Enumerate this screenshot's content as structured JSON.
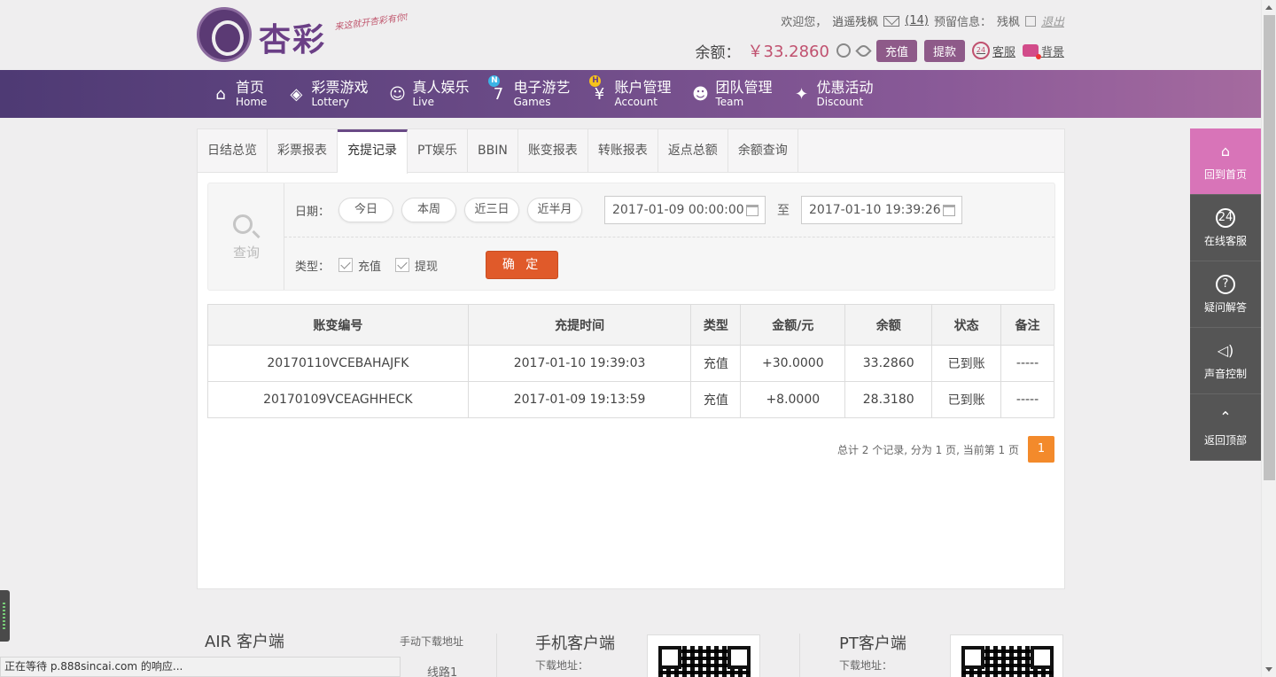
{
  "header": {
    "logo_text": "杏彩",
    "logo_slogan": "来这就开杏彩有你!",
    "welcome": "欢迎您，",
    "username": "逍遥残枫",
    "mail_count": "(14)",
    "reserved_info_label": "预留信息：",
    "reserved_info": "残枫",
    "logout": "退出",
    "balance_label": "余额：",
    "balance_value": "￥33.2860",
    "recharge": "充值",
    "withdraw": "提款",
    "service": "客服",
    "service_icon_text": "24",
    "background": "背景"
  },
  "nav": [
    {
      "cn": "首页",
      "en": "Home",
      "icon": "home-icon"
    },
    {
      "cn": "彩票游戏",
      "en": "Lottery",
      "icon": "lottery-icon"
    },
    {
      "cn": "真人娱乐",
      "en": "Live",
      "icon": "live-icon",
      "badge": "N"
    },
    {
      "cn": "电子游艺",
      "en": "Games",
      "icon": "slot-seven-icon",
      "badge": "H"
    },
    {
      "cn": "账户管理",
      "en": "Account",
      "icon": "yen-coin-icon"
    },
    {
      "cn": "团队管理",
      "en": "Team",
      "icon": "team-icon"
    },
    {
      "cn": "优惠活动",
      "en": "Discount",
      "icon": "gift-icon"
    }
  ],
  "tabs": [
    "日结总览",
    "彩票报表",
    "充提记录",
    "PT娱乐",
    "BBIN",
    "账变报表",
    "转账报表",
    "返点总额",
    "余额查询"
  ],
  "active_tab": "充提记录",
  "query": {
    "title": "查询",
    "date_label": "日期：",
    "quick": [
      "今日",
      "本周",
      "近三日",
      "近半月"
    ],
    "start": "2017-01-09 00:00:00",
    "to": "至",
    "end": "2017-01-10 19:39:26",
    "type_label": "类型：",
    "types": [
      "充值",
      "提现"
    ],
    "confirm": "确 定"
  },
  "table": {
    "headers": [
      "账变编号",
      "充提时间",
      "类型",
      "金额/元",
      "余额",
      "状态",
      "备注"
    ],
    "rows": [
      [
        "20170110VCEBAHAJFK",
        "2017-01-10 19:39:03",
        "充值",
        "+30.0000",
        "33.2860",
        "已到账",
        "-----"
      ],
      [
        "20170109VCEAGHHECK",
        "2017-01-09 19:13:59",
        "充值",
        "+8.0000",
        "28.3180",
        "已到账",
        "-----"
      ]
    ]
  },
  "pager": {
    "summary": "总计 2 个记录, 分为 1 页, 当前第 1 页",
    "page": "1"
  },
  "footer": {
    "air": "AIR 客户端",
    "manual": "手动下载地址",
    "line1": "线路1",
    "mobile": "手机客户端",
    "mobile_dl": "下载地址：",
    "pt": "PT客户端",
    "pt_dl": "下载地址："
  },
  "side": [
    {
      "label": "回到首页",
      "icon": "home-icon"
    },
    {
      "label": "在线客服",
      "icon": "headset-24-icon",
      "icon_text": "24"
    },
    {
      "label": "疑问解答",
      "icon": "question-icon",
      "icon_text": "?"
    },
    {
      "label": "声音控制",
      "icon": "speaker-icon"
    },
    {
      "label": "返回顶部",
      "icon": "back-to-top-icon"
    }
  ],
  "status_bar": "正在等待 p.888sincai.com 的响应..."
}
